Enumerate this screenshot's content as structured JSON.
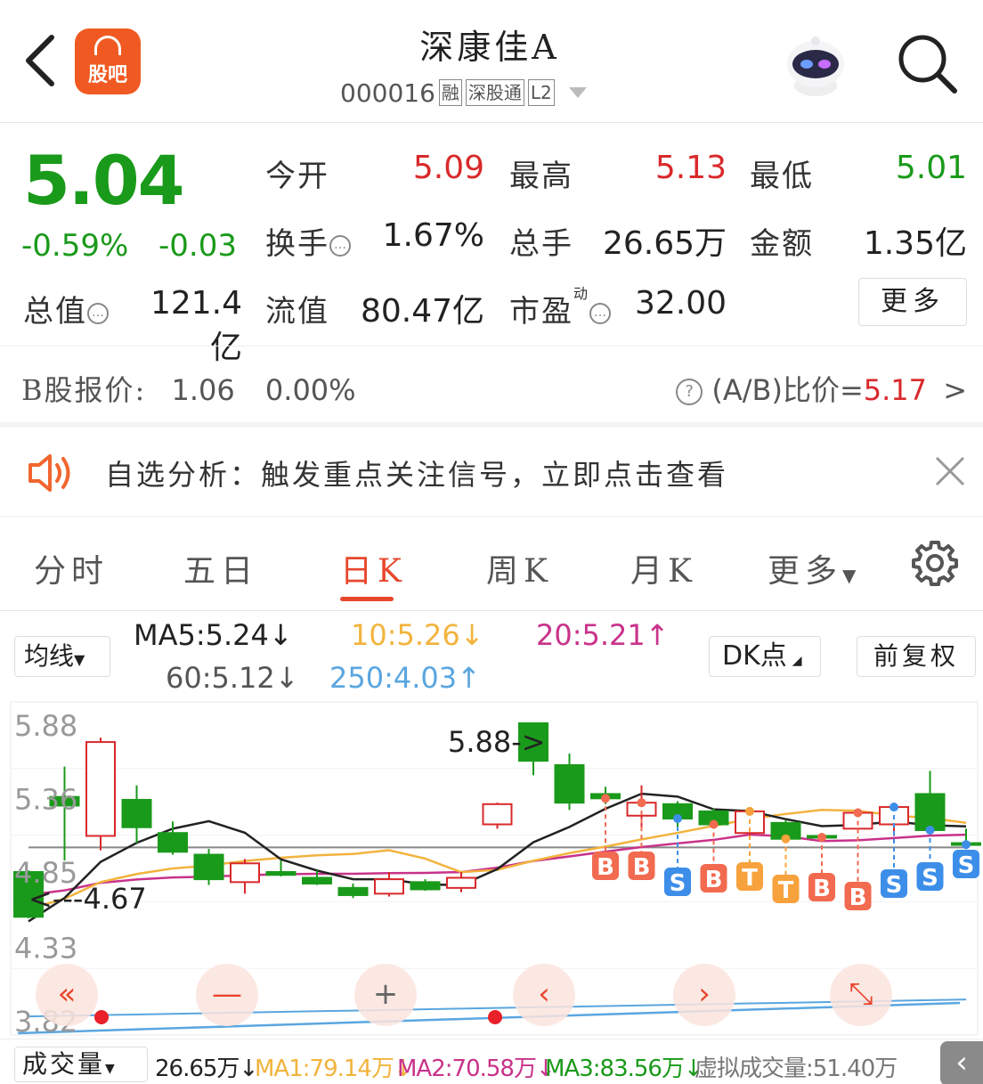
{
  "header": {
    "title": "深康佳A",
    "code": "000016",
    "tags": [
      "融",
      "深股通",
      "L2"
    ],
    "logo_label": "股吧"
  },
  "quote": {
    "price": "5.04",
    "change_pct": "-0.59%",
    "change": "-0.03",
    "open_label": "今开",
    "open": "5.09",
    "high_label": "最高",
    "high": "5.13",
    "low_label": "最低",
    "low": "5.01",
    "turnover_label": "换手",
    "turnover": "1.67%",
    "volume_label": "总手",
    "volume": "26.65万",
    "amount_label": "金额",
    "amount": "1.35亿",
    "mcap_label": "总值",
    "mcap": "121.4亿",
    "float_label": "流值",
    "float_cap": "80.47亿",
    "pe_label": "市盈",
    "pe_sup": "动",
    "pe": "32.00",
    "more": "更多"
  },
  "bshare": {
    "label": "B股报价:",
    "price": "1.06",
    "pct": "0.00%",
    "ratio_label": "(A/B)比价=",
    "ratio": "5.17",
    "arrow": ">"
  },
  "notice": {
    "text": "自选分析：触发重点关注信号，立即点击查看"
  },
  "tabs": [
    "分时",
    "五日",
    "日K",
    "周K",
    "月K",
    "更多"
  ],
  "ma": {
    "selector": "均线",
    "ma5": "MA5:5.24",
    "ma10": "10:5.26",
    "ma20": "20:5.21",
    "ma60": "60:5.12",
    "ma250": "250:4.03",
    "arrows": [
      "↓",
      "↓",
      "↑",
      "↓",
      "↑"
    ],
    "dk": "DK点",
    "adjust": "前复权"
  },
  "chart_data": {
    "type": "candlestick",
    "y_ticks": [
      "5.88",
      "5.36",
      "4.85",
      "4.33",
      "3.82"
    ],
    "annotations": [
      "5.88->",
      "<---4.67"
    ],
    "ohlc": [
      [
        4.85,
        4.86,
        4.53,
        4.54
      ],
      [
        5.37,
        5.58,
        4.93,
        5.31
      ],
      [
        5.1,
        5.78,
        5.0,
        5.75
      ],
      [
        5.35,
        5.45,
        5.05,
        5.16
      ],
      [
        5.12,
        5.2,
        4.97,
        4.99
      ],
      [
        4.97,
        5.01,
        4.76,
        4.8
      ],
      [
        4.78,
        4.94,
        4.7,
        4.91
      ],
      [
        4.85,
        4.93,
        4.82,
        4.83
      ],
      [
        4.81,
        4.86,
        4.76,
        4.77
      ],
      [
        4.74,
        4.77,
        4.67,
        4.69
      ],
      [
        4.7,
        4.85,
        4.68,
        4.8
      ],
      [
        4.78,
        4.8,
        4.72,
        4.73
      ],
      [
        4.74,
        4.85,
        4.71,
        4.81
      ],
      [
        5.18,
        5.33,
        5.15,
        5.32
      ],
      [
        5.88,
        5.88,
        5.52,
        5.62
      ],
      [
        5.59,
        5.67,
        5.28,
        5.33
      ],
      [
        5.39,
        5.44,
        5.32,
        5.36
      ],
      [
        5.24,
        5.45,
        5.14,
        5.33
      ],
      [
        5.32,
        5.34,
        5.16,
        5.22
      ],
      [
        5.27,
        5.29,
        5.15,
        5.18
      ],
      [
        5.12,
        5.29,
        5.1,
        5.27
      ],
      [
        5.19,
        5.21,
        5.08,
        5.08
      ],
      [
        5.1,
        5.12,
        5.08,
        5.09
      ],
      [
        5.15,
        5.28,
        5.13,
        5.26
      ],
      [
        5.18,
        5.32,
        5.1,
        5.3
      ],
      [
        5.39,
        5.55,
        5.13,
        5.14
      ],
      [
        5.05,
        5.15,
        5.01,
        5.04
      ]
    ],
    "signals": [
      "B",
      "B",
      "S",
      "B",
      "T",
      "T",
      "B",
      "B",
      "S",
      "S",
      "S"
    ],
    "signal_colors": {
      "B": "#f26a4f",
      "S": "#3d8ee8",
      "T": "#f7a23c"
    },
    "colors": {
      "up": "#d9292b",
      "down": "#1a9a1a",
      "ma5": "#222222",
      "ma10": "#f2b33d",
      "ma20": "#c9328a",
      "ma60": "#888888",
      "ma250": "#5aa6e0"
    }
  },
  "volume": {
    "selector": "成交量",
    "value": "26.65万",
    "ma1": "MA1:79.14万",
    "ma2": "MA2:70.58万",
    "ma3": "MA3:83.56万",
    "virtual": "虚拟成交量:51.40万",
    "arrow": "↓"
  }
}
